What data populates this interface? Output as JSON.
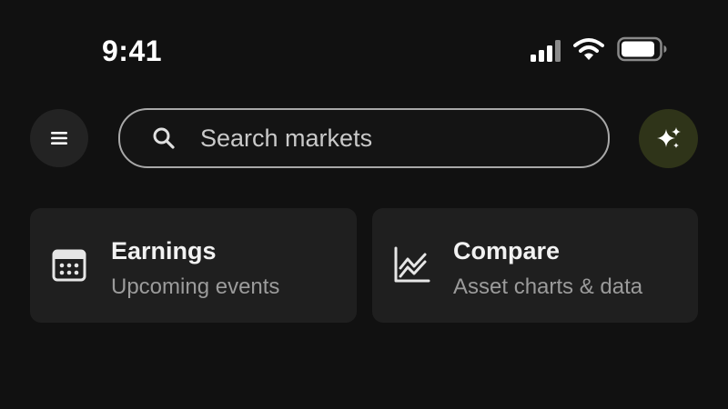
{
  "status_bar": {
    "time": "9:41",
    "icons": [
      "cellular-signal-icon",
      "wifi-icon",
      "battery-icon"
    ]
  },
  "top_bar": {
    "menu_icon": "hamburger-menu-icon",
    "search": {
      "icon": "search-icon",
      "placeholder": "Search markets",
      "value": ""
    },
    "ai_icon": "sparkles-icon"
  },
  "cards": [
    {
      "icon": "calendar-icon",
      "title": "Earnings",
      "subtitle": "Upcoming events"
    },
    {
      "icon": "line-chart-icon",
      "title": "Compare",
      "subtitle": "Asset charts & data"
    }
  ],
  "colors": {
    "background": "#111111",
    "card_background": "#1f1f1f",
    "text_primary": "#f2f2f2",
    "text_secondary": "#9b9b9b",
    "ai_button_background": "#2f3419"
  }
}
